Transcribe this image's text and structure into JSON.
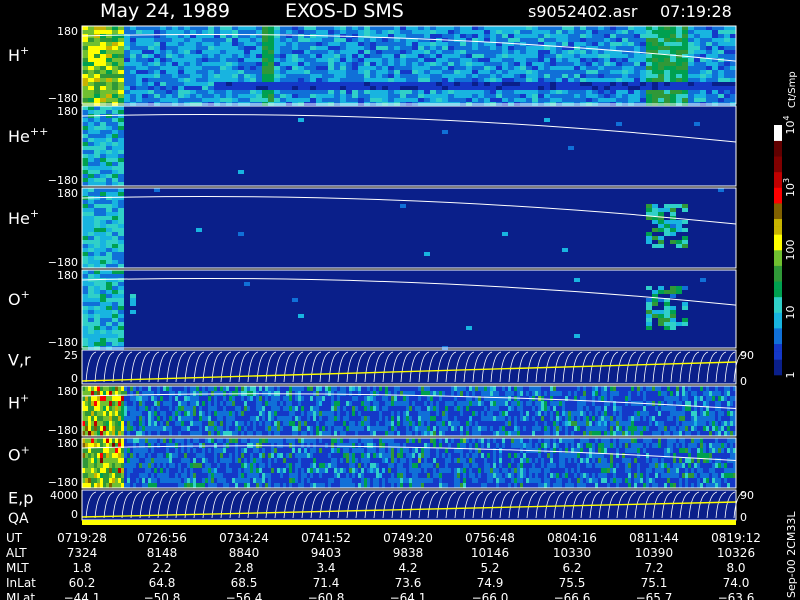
{
  "header": {
    "date": "May 24, 1989",
    "instrument": "EXOS-D SMS",
    "file": "s9052402.asr",
    "time": "07:19:28"
  },
  "colors": {
    "background": "#000000",
    "spectrogram_base": "#0a1f8a",
    "trace": "#ffffff",
    "highlight": "#ffff00"
  },
  "chart_data": {
    "type": "heatmap",
    "panels": [
      {
        "id": "h-plus",
        "label": "H",
        "sup": "+",
        "ymax": "180",
        "ymin": "−180",
        "texture": "high"
      },
      {
        "id": "he-pp",
        "label": "He",
        "sup": "++",
        "ymax": "180",
        "ymin": "−180",
        "texture": "low"
      },
      {
        "id": "he-plus",
        "label": "He",
        "sup": "+",
        "ymax": "180",
        "ymin": "−180",
        "texture": "low"
      },
      {
        "id": "o-plus",
        "label": "O",
        "sup": "+",
        "ymax": "180",
        "ymin": "−180",
        "texture": "low"
      },
      {
        "id": "vr",
        "label": "V,r",
        "sup": "",
        "ymax": "25",
        "ymin": "0",
        "right_top": "90",
        "right_bot": "0",
        "texture": "lines"
      },
      {
        "id": "h-plus-2",
        "label": "H",
        "sup": "+",
        "ymax": "180",
        "ymin": "−180",
        "texture": "streak"
      },
      {
        "id": "o-plus-2",
        "label": "O",
        "sup": "+",
        "ymax": "180",
        "ymin": "−180",
        "texture": "streak"
      },
      {
        "id": "ep",
        "label": "E,p",
        "sup": "",
        "ymax": "4000",
        "ymin": "0",
        "right_top": "90",
        "right_bot": "0",
        "texture": "lines"
      }
    ],
    "qa_label": "QA",
    "colorbar": {
      "unit": "Ct/Smp",
      "ticks": [
        {
          "label": "1",
          "sup": "",
          "value": 1
        },
        {
          "label": "10",
          "sup": "",
          "value": 10
        },
        {
          "label": "100",
          "sup": "",
          "value": 100
        },
        {
          "label": "10",
          "sup": "3",
          "value": 1000
        },
        {
          "label": "10",
          "sup": "4",
          "value": 10000
        }
      ],
      "colors": [
        "#0a1f8a",
        "#0a1f8a",
        "#1438c8",
        "#1438c8",
        "#1070d8",
        "#1070d8",
        "#18b4e0",
        "#18b4e0",
        "#30d0c8",
        "#30d0c8",
        "#00a050",
        "#00a050",
        "#309838",
        "#309838",
        "#70c030",
        "#70c030",
        "#ffff00",
        "#ffff00",
        "#c8b400",
        "#c8b400",
        "#806000",
        "#806000",
        "#ff0000",
        "#ff0000",
        "#c00000",
        "#c00000",
        "#800000",
        "#800000",
        "#600000",
        "#600000",
        "#ffffff",
        "#ffffff"
      ]
    },
    "side_label": "Sep-00 2CM33L",
    "ephemeris": {
      "rows": [
        {
          "name": "UT",
          "values": [
            "0719:28",
            "0726:56",
            "0734:24",
            "0741:52",
            "0749:20",
            "0756:48",
            "0804:16",
            "0811:44",
            "0819:12"
          ]
        },
        {
          "name": "ALT",
          "values": [
            "7324",
            "8148",
            "8840",
            "9403",
            "9838",
            "10146",
            "10330",
            "10390",
            "10326"
          ]
        },
        {
          "name": "MLT",
          "values": [
            "1.8",
            "2.2",
            "2.8",
            "3.4",
            "4.2",
            "5.2",
            "6.2",
            "7.2",
            "8.0"
          ]
        },
        {
          "name": "InLat",
          "values": [
            "60.2",
            "64.8",
            "68.5",
            "71.4",
            "73.6",
            "74.9",
            "75.5",
            "75.1",
            "74.0"
          ]
        },
        {
          "name": "MLat",
          "values": [
            "−44.1",
            "−50.8",
            "−56.4",
            "−60.8",
            "−64.1",
            "−66.0",
            "−66.6",
            "−65.7",
            "−63.6"
          ]
        }
      ]
    }
  }
}
